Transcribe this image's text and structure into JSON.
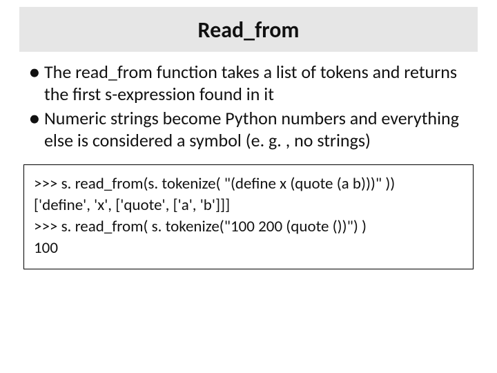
{
  "title": "Read_from",
  "bullets": [
    "The read_from function takes a list of tokens and returns the first s-expression found in it",
    "Numeric strings become Python numbers and everything else is considered a symbol (e. g. , no strings)"
  ],
  "code_lines": [
    ">>> s. read_from(s. tokenize( \"(define x (quote (a b)))\" ))",
    "['define', 'x', ['quote', ['a', 'b']]]",
    ">>> s. read_from( s. tokenize(\"100 200 (quote ())\") )",
    "100"
  ]
}
